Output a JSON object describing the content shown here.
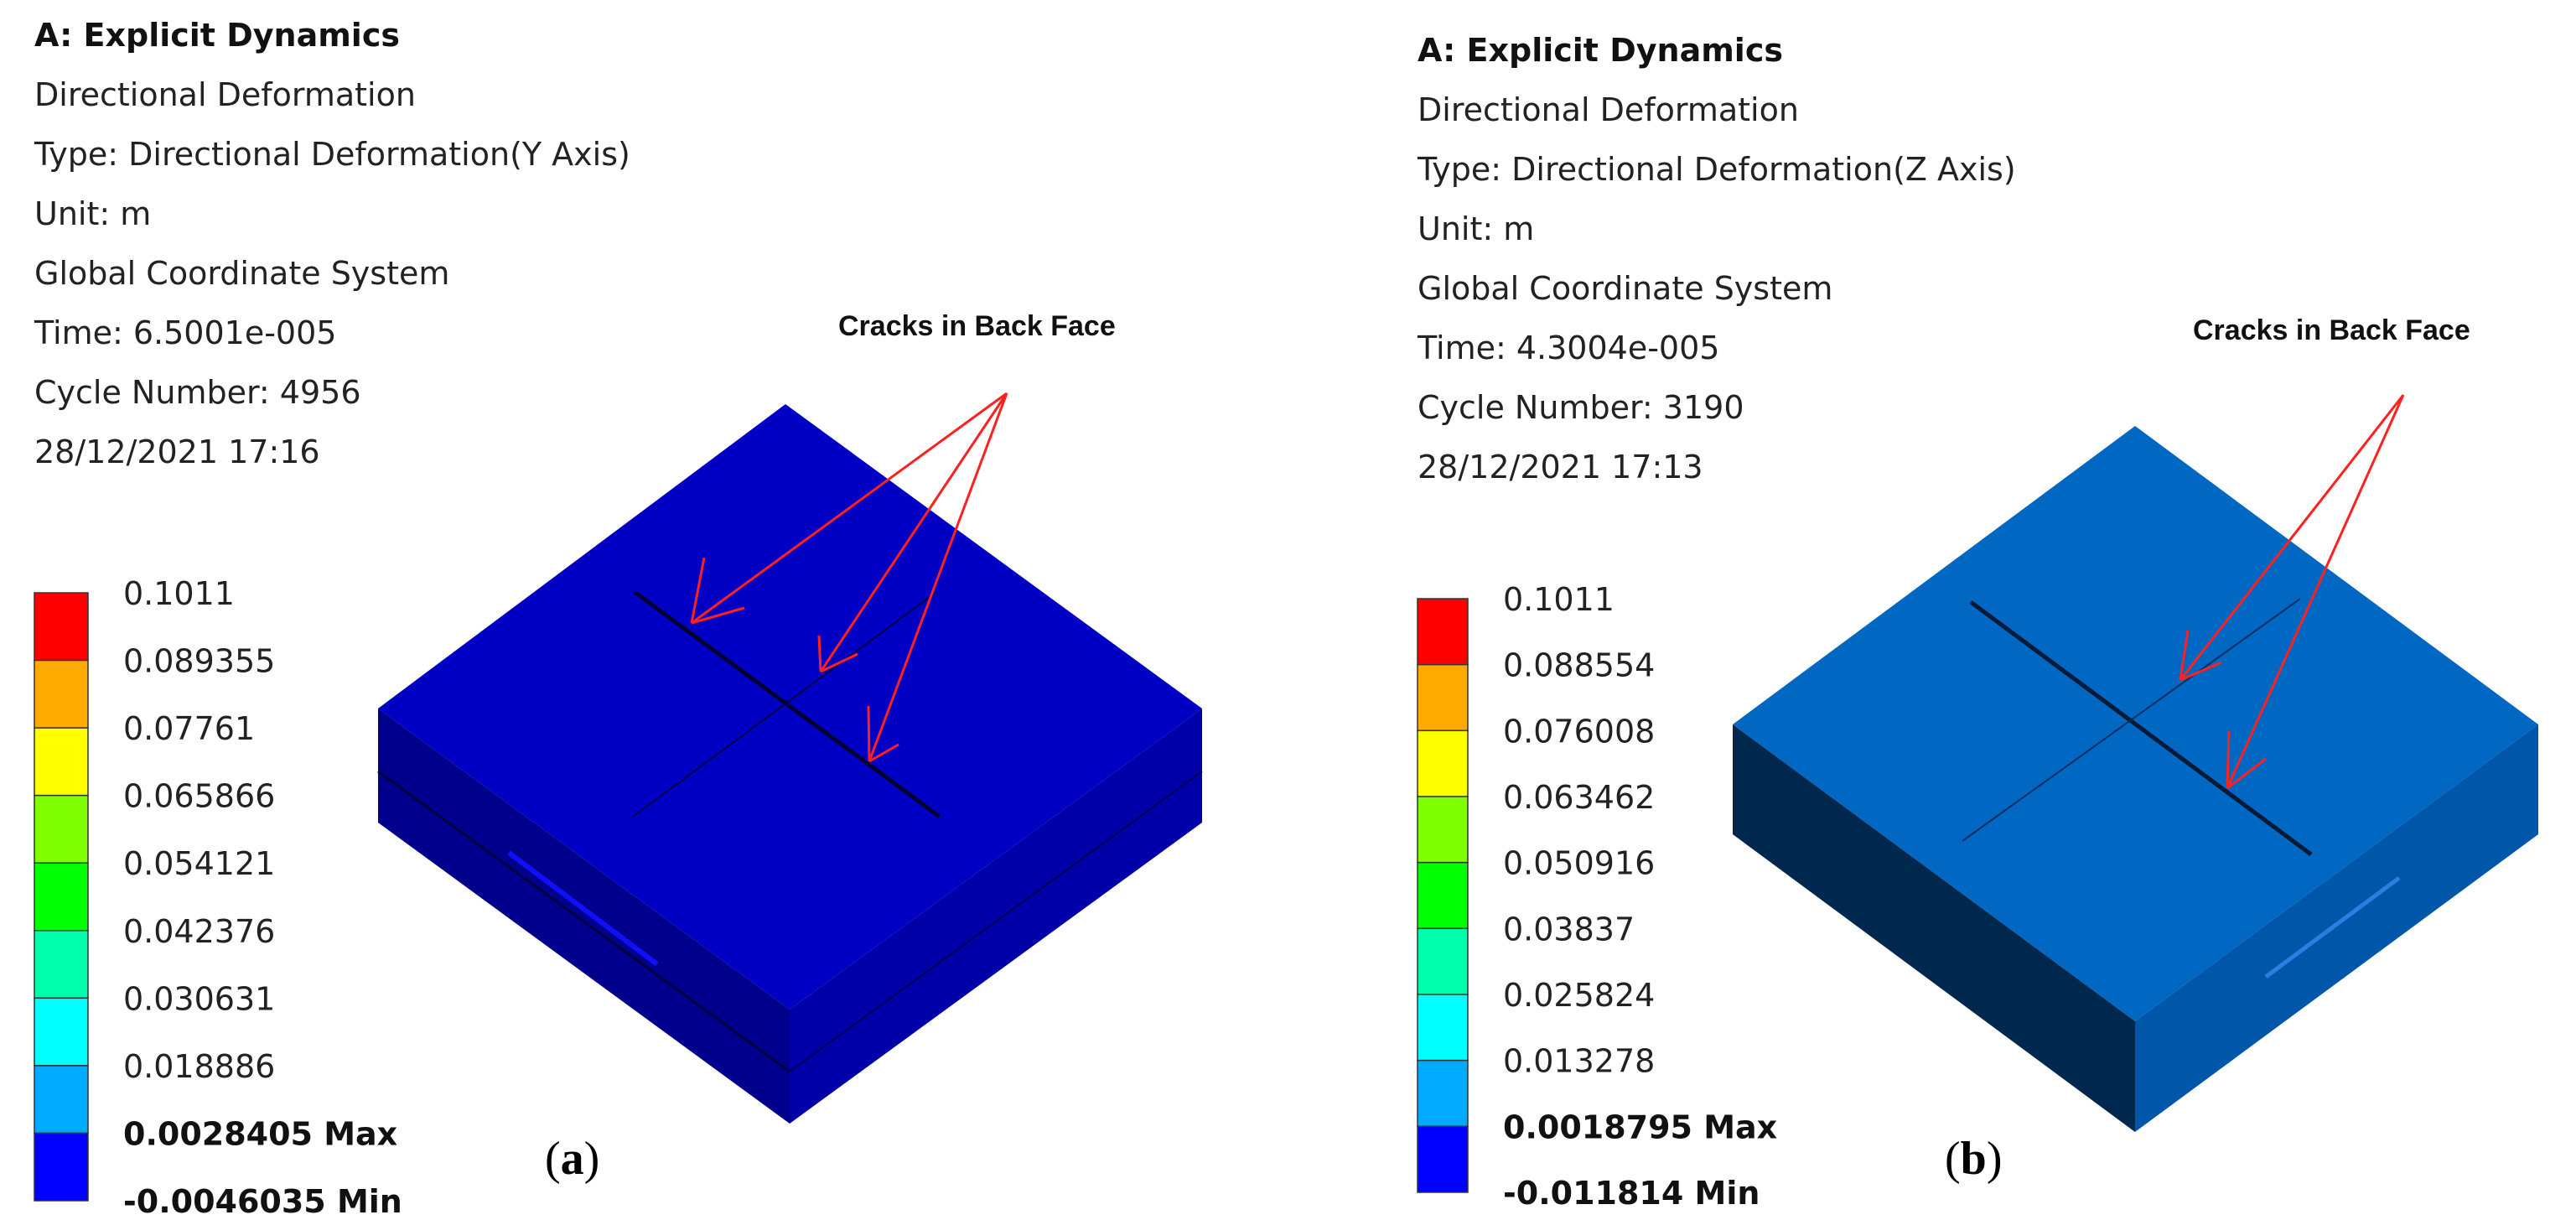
{
  "legend_colors": [
    "#ff0000",
    "#ffaa00",
    "#ffff00",
    "#80ff00",
    "#00ff00",
    "#00ffaa",
    "#00ffff",
    "#00aaff",
    "#0000ff"
  ],
  "panels": [
    {
      "title": "A: Explicit Dynamics",
      "info": [
        "Directional Deformation",
        "Type: Directional Deformation(Y Axis)",
        "Unit: m",
        "Global Coordinate System",
        "Time: 6.5001e-005",
        "Cycle Number: 4956",
        "28/12/2021 17:16"
      ],
      "legend_values": [
        "0.1011",
        "0.089355",
        "0.07761",
        "0.065866",
        "0.054121",
        "0.042376",
        "0.030631",
        "0.018886"
      ],
      "legend_max": "0.0028405 Max",
      "legend_min": "-0.0046035 Min",
      "annotation": "Cracks in Back Face",
      "caption_letter": "a",
      "block_colors": {
        "top": "#0000c4",
        "left": "#00008c",
        "right": "#0000a8"
      }
    },
    {
      "title": "A: Explicit Dynamics",
      "info": [
        "Directional Deformation",
        "Type: Directional Deformation(Z Axis)",
        "Unit: m",
        "Global Coordinate System",
        "Time: 4.3004e-005",
        "Cycle Number: 3190",
        "28/12/2021 17:13"
      ],
      "legend_values": [
        "0.1011",
        "0.088554",
        "0.076008",
        "0.063462",
        "0.050916",
        "0.03837",
        "0.025824",
        "0.013278"
      ],
      "legend_max": "0.0018795 Max",
      "legend_min": "-0.011814 Min",
      "annotation": "Cracks in Back Face",
      "caption_letter": "b",
      "block_colors": {
        "top": "#0067c2",
        "left": "#00284f",
        "right": "#0056a8"
      }
    }
  ]
}
